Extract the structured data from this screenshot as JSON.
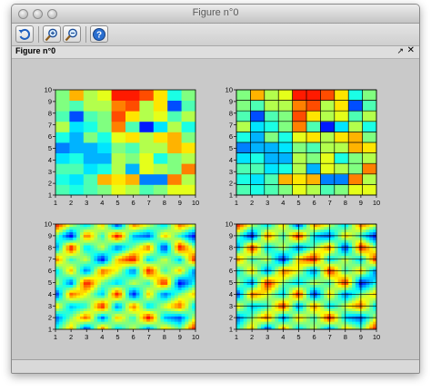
{
  "window": {
    "title": "Figure n°0"
  },
  "toolbar": {
    "buttons": [
      {
        "name": "rotate-button",
        "icon": "rotate-icon"
      },
      {
        "name": "zoom-button",
        "icon": "zoom-icon"
      },
      {
        "name": "unzoom-button",
        "icon": "unzoom-icon"
      },
      {
        "name": "help-button",
        "icon": "help-icon"
      }
    ]
  },
  "figure_panel": {
    "title": "Figure n°0",
    "undock_glyph": "↗",
    "close_glyph": "✕"
  },
  "chart_data": [
    {
      "type": "heatmap",
      "style": "flat",
      "edges": false,
      "xlim": [
        1,
        10
      ],
      "ylim": [
        1,
        10
      ],
      "xticks": [
        "1",
        "2",
        "3",
        "4",
        "5",
        "6",
        "7",
        "8",
        "9",
        "10"
      ],
      "yticks": [
        "1",
        "2",
        "3",
        "4",
        "5",
        "6",
        "7",
        "8",
        "9",
        "10"
      ],
      "colormap": "jet",
      "value_range": [
        0,
        1
      ],
      "z": [
        [
          0.45,
          0.4,
          0.45,
          0.5,
          0.6,
          0.55,
          0.45,
          0.5,
          0.6,
          0.6
        ],
        [
          0.4,
          0.35,
          0.45,
          0.7,
          0.65,
          0.7,
          0.25,
          0.25,
          0.75,
          0.55
        ],
        [
          0.45,
          0.45,
          0.35,
          0.4,
          0.55,
          0.3,
          0.6,
          0.55,
          0.5,
          0.75
        ],
        [
          0.35,
          0.4,
          0.3,
          0.3,
          0.55,
          0.5,
          0.6,
          0.4,
          0.5,
          0.55
        ],
        [
          0.25,
          0.3,
          0.3,
          0.35,
          0.5,
          0.45,
          0.55,
          0.55,
          0.7,
          0.65
        ],
        [
          0.4,
          0.3,
          0.5,
          0.4,
          0.6,
          0.65,
          0.55,
          0.65,
          0.7,
          0.5
        ],
        [
          0.55,
          0.35,
          0.4,
          0.5,
          0.75,
          0.45,
          0.15,
          0.35,
          0.55,
          0.4
        ],
        [
          0.45,
          0.2,
          0.45,
          0.5,
          0.8,
          0.65,
          0.55,
          0.6,
          0.45,
          0.55
        ],
        [
          0.5,
          0.45,
          0.55,
          0.55,
          0.75,
          0.8,
          0.55,
          0.65,
          0.2,
          0.45
        ],
        [
          0.5,
          0.7,
          0.55,
          0.6,
          0.85,
          0.85,
          0.8,
          0.65,
          0.4,
          0.5
        ]
      ]
    },
    {
      "type": "heatmap",
      "style": "flat",
      "edges": true,
      "xlim": [
        1,
        10
      ],
      "ylim": [
        1,
        10
      ],
      "xticks": [
        "1",
        "2",
        "3",
        "4",
        "5",
        "6",
        "7",
        "8",
        "9",
        "10"
      ],
      "yticks": [
        "1",
        "2",
        "3",
        "4",
        "5",
        "6",
        "7",
        "8",
        "9",
        "10"
      ],
      "colormap": "jet",
      "value_range": [
        0,
        1
      ],
      "z": [
        [
          0.45,
          0.4,
          0.45,
          0.5,
          0.6,
          0.55,
          0.45,
          0.5,
          0.6,
          0.6
        ],
        [
          0.4,
          0.35,
          0.45,
          0.7,
          0.65,
          0.7,
          0.25,
          0.25,
          0.75,
          0.55
        ],
        [
          0.45,
          0.45,
          0.35,
          0.4,
          0.55,
          0.3,
          0.6,
          0.55,
          0.5,
          0.75
        ],
        [
          0.35,
          0.4,
          0.3,
          0.3,
          0.55,
          0.5,
          0.6,
          0.4,
          0.5,
          0.55
        ],
        [
          0.25,
          0.3,
          0.3,
          0.35,
          0.5,
          0.45,
          0.55,
          0.55,
          0.7,
          0.65
        ],
        [
          0.4,
          0.3,
          0.5,
          0.4,
          0.6,
          0.65,
          0.55,
          0.65,
          0.7,
          0.5
        ],
        [
          0.55,
          0.35,
          0.4,
          0.5,
          0.75,
          0.45,
          0.15,
          0.35,
          0.55,
          0.4
        ],
        [
          0.45,
          0.2,
          0.45,
          0.5,
          0.8,
          0.65,
          0.55,
          0.6,
          0.45,
          0.55
        ],
        [
          0.5,
          0.45,
          0.55,
          0.55,
          0.75,
          0.8,
          0.55,
          0.65,
          0.2,
          0.45
        ],
        [
          0.5,
          0.7,
          0.55,
          0.6,
          0.85,
          0.85,
          0.8,
          0.65,
          0.4,
          0.5
        ]
      ]
    },
    {
      "type": "heatmap",
      "style": "interp",
      "edges": false,
      "xlim": [
        1,
        10
      ],
      "ylim": [
        1,
        10
      ],
      "xticks": [
        "1",
        "2",
        "3",
        "4",
        "5",
        "6",
        "7",
        "8",
        "9",
        "10"
      ],
      "yticks": [
        "1",
        "2",
        "3",
        "4",
        "5",
        "6",
        "7",
        "8",
        "9",
        "10"
      ],
      "colormap": "jet",
      "value_range": [
        0,
        1
      ],
      "z": [
        [
          0.4,
          0.7,
          0.1,
          0.8,
          0.3,
          0.6,
          0.2,
          0.7,
          0.5,
          0.9
        ],
        [
          0.2,
          0.5,
          0.8,
          0.2,
          0.7,
          0.4,
          0.9,
          0.3,
          0.2,
          0.6
        ],
        [
          0.7,
          0.3,
          0.4,
          0.9,
          0.2,
          0.8,
          0.3,
          0.6,
          0.8,
          0.3
        ],
        [
          0.1,
          0.8,
          0.6,
          0.3,
          0.9,
          0.1,
          0.7,
          0.2,
          0.5,
          0.7
        ],
        [
          0.6,
          0.2,
          0.9,
          0.5,
          0.3,
          0.6,
          0.4,
          0.9,
          0.1,
          0.4
        ],
        [
          0.3,
          0.7,
          0.2,
          0.8,
          0.6,
          0.2,
          0.9,
          0.4,
          0.7,
          0.2
        ],
        [
          0.8,
          0.4,
          0.6,
          0.1,
          0.7,
          0.9,
          0.3,
          0.6,
          0.3,
          0.9
        ],
        [
          0.2,
          0.9,
          0.3,
          0.6,
          0.2,
          0.5,
          0.8,
          0.1,
          0.9,
          0.5
        ],
        [
          0.5,
          0.1,
          0.8,
          0.4,
          0.9,
          0.3,
          0.2,
          0.7,
          0.4,
          0.1
        ],
        [
          0.9,
          0.6,
          0.3,
          0.7,
          0.1,
          0.8,
          0.6,
          0.3,
          0.8,
          0.6
        ]
      ]
    },
    {
      "type": "heatmap",
      "style": "interp",
      "edges": true,
      "xlim": [
        1,
        10
      ],
      "ylim": [
        1,
        10
      ],
      "xticks": [
        "1",
        "2",
        "3",
        "4",
        "5",
        "6",
        "7",
        "8",
        "9",
        "10"
      ],
      "yticks": [
        "1",
        "2",
        "3",
        "4",
        "5",
        "6",
        "7",
        "8",
        "9",
        "10"
      ],
      "colormap": "jet",
      "value_range": [
        0,
        1
      ],
      "z": [
        [
          0.4,
          0.7,
          0.1,
          0.8,
          0.3,
          0.6,
          0.2,
          0.7,
          0.5,
          0.9
        ],
        [
          0.2,
          0.5,
          0.8,
          0.2,
          0.7,
          0.4,
          0.9,
          0.3,
          0.2,
          0.6
        ],
        [
          0.7,
          0.3,
          0.4,
          0.9,
          0.2,
          0.8,
          0.3,
          0.6,
          0.8,
          0.3
        ],
        [
          0.1,
          0.8,
          0.6,
          0.3,
          0.9,
          0.1,
          0.7,
          0.2,
          0.5,
          0.7
        ],
        [
          0.6,
          0.2,
          0.9,
          0.5,
          0.3,
          0.6,
          0.4,
          0.9,
          0.1,
          0.4
        ],
        [
          0.3,
          0.7,
          0.2,
          0.8,
          0.6,
          0.2,
          0.9,
          0.4,
          0.7,
          0.2
        ],
        [
          0.8,
          0.4,
          0.6,
          0.1,
          0.7,
          0.9,
          0.3,
          0.6,
          0.3,
          0.9
        ],
        [
          0.2,
          0.9,
          0.3,
          0.6,
          0.2,
          0.5,
          0.8,
          0.1,
          0.9,
          0.5
        ],
        [
          0.5,
          0.1,
          0.8,
          0.4,
          0.9,
          0.3,
          0.2,
          0.7,
          0.4,
          0.1
        ],
        [
          0.9,
          0.6,
          0.3,
          0.7,
          0.1,
          0.8,
          0.6,
          0.3,
          0.8,
          0.6
        ]
      ]
    }
  ]
}
